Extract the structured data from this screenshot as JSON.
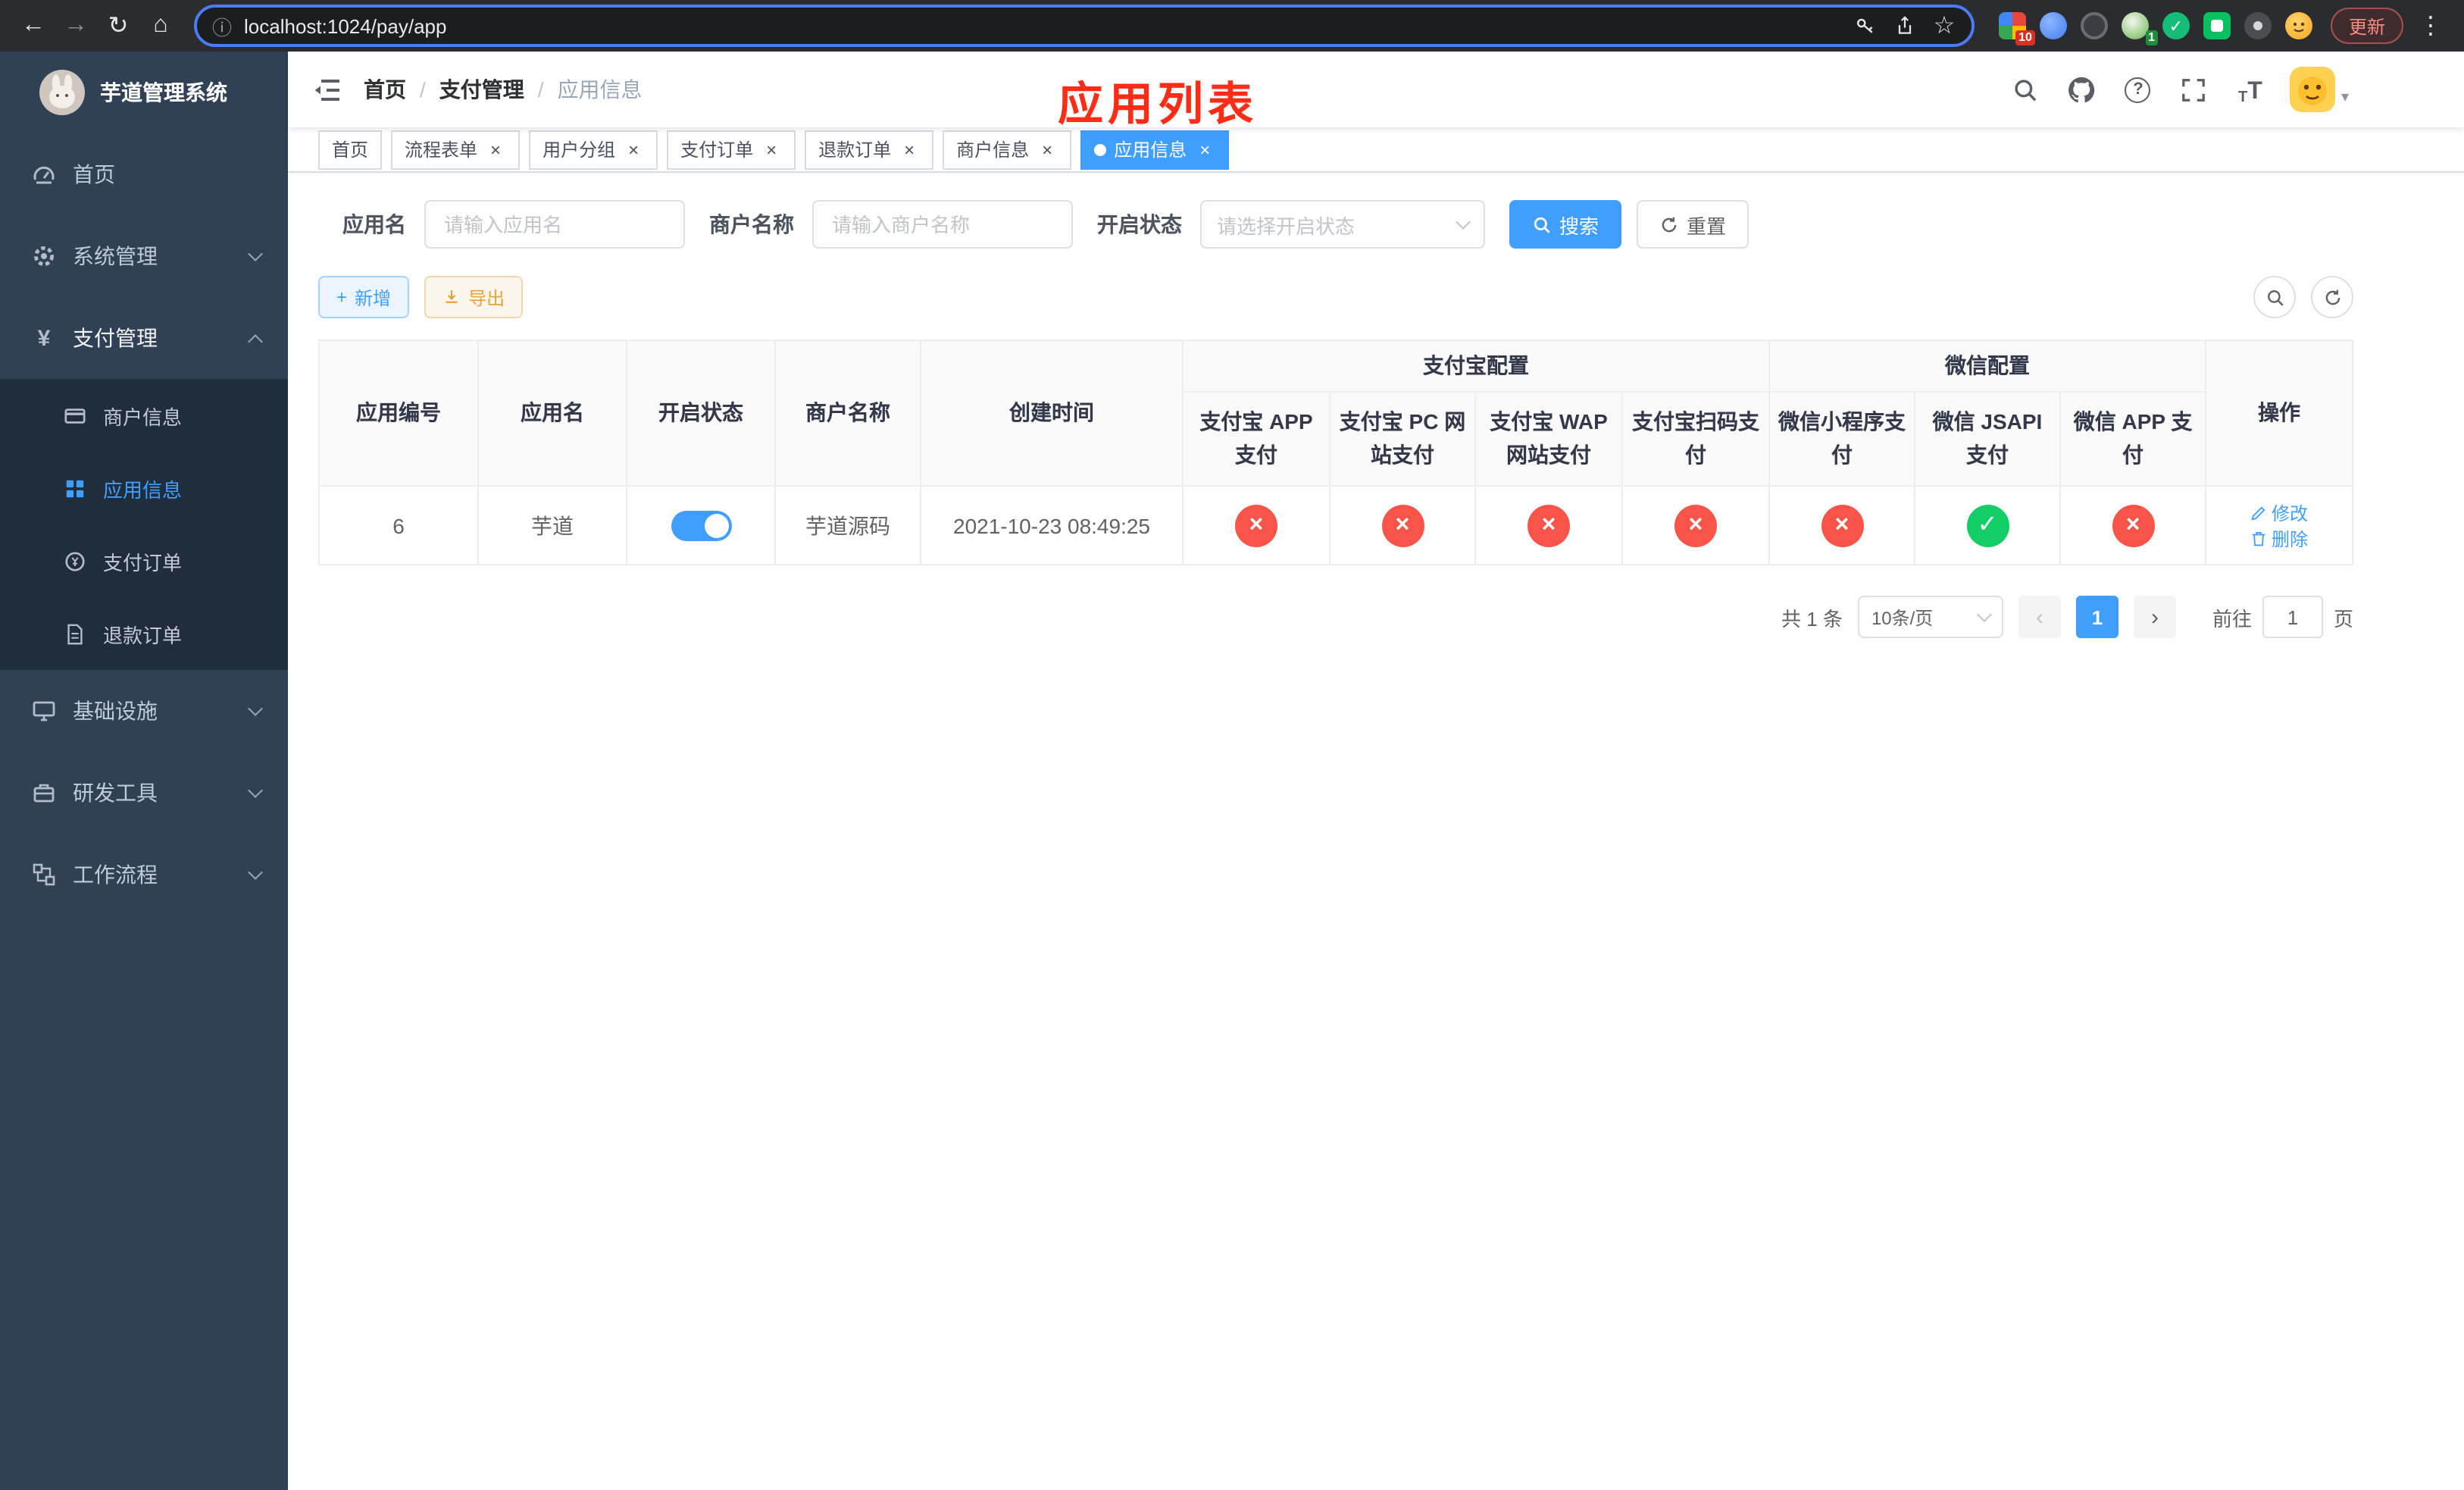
{
  "colors": {
    "accent": "#409eff",
    "success": "#13ce66",
    "danger": "#f9544a",
    "warning": "#e6a23c",
    "annotation_red": "#ff2d17",
    "sidebar_bg": "#304156",
    "submenu_bg": "#1f2d3d"
  },
  "icons": {
    "back": "←",
    "forward": "→",
    "reload": "↻",
    "home": "⌂",
    "info": "ⓘ",
    "star": "☆",
    "menu_dots": "⋮",
    "cross": "×",
    "check": "✓",
    "plus": "+",
    "prev": "‹",
    "next": "›",
    "question": "?",
    "yen": "¥",
    "caret_down": "▾"
  },
  "browser": {
    "url": "localhost:1024/pay/app",
    "update_label": "更新",
    "ext_badge_primary": "10",
    "ext_badge_secondary": "1"
  },
  "sidebar": {
    "title": "芋道管理系统",
    "items": [
      {
        "label": "首页"
      },
      {
        "label": "系统管理"
      },
      {
        "label": "支付管理"
      },
      {
        "label": "基础设施"
      },
      {
        "label": "研发工具"
      },
      {
        "label": "工作流程"
      }
    ],
    "payment_children": [
      {
        "label": "商户信息"
      },
      {
        "label": "应用信息"
      },
      {
        "label": "支付订单"
      },
      {
        "label": "退款订单"
      }
    ]
  },
  "header": {
    "breadcrumb": [
      "首页",
      "支付管理",
      "应用信息"
    ],
    "separator": "/",
    "annotation": "应用列表"
  },
  "tabs": [
    {
      "label": "首页",
      "closable": false,
      "active": false
    },
    {
      "label": "流程表单",
      "closable": true,
      "active": false
    },
    {
      "label": "用户分组",
      "closable": true,
      "active": false
    },
    {
      "label": "支付订单",
      "closable": true,
      "active": false
    },
    {
      "label": "退款订单",
      "closable": true,
      "active": false
    },
    {
      "label": "商户信息",
      "closable": true,
      "active": false
    },
    {
      "label": "应用信息",
      "closable": true,
      "active": true
    }
  ],
  "filters": {
    "app_name_label": "应用名",
    "app_name_placeholder": "请输入应用名",
    "merchant_label": "商户名称",
    "merchant_placeholder": "请输入商户名称",
    "status_label": "开启状态",
    "status_placeholder": "请选择开启状态",
    "search_label": "搜索",
    "reset_label": "重置"
  },
  "toolbar": {
    "add_label": "新增",
    "export_label": "导出"
  },
  "table": {
    "columns_simple": [
      "应用编号",
      "应用名",
      "开启状态",
      "商户名称",
      "创建时间"
    ],
    "groups": [
      {
        "label": "支付宝配置",
        "columns": [
          "支付宝 APP 支付",
          "支付宝 PC 网站支付",
          "支付宝 WAP 网站支付",
          "支付宝扫码支付"
        ]
      },
      {
        "label": "微信配置",
        "columns": [
          "微信小程序支付",
          "微信 JSAPI 支付",
          "微信 APP 支付"
        ]
      }
    ],
    "ops_label": "操作",
    "row": {
      "id": "6",
      "name": "芋道",
      "enabled": true,
      "merchant": "芋道源码",
      "created_at": "2021-10-23 08:49:25",
      "configs": [
        false,
        false,
        false,
        false,
        false,
        true,
        false
      ],
      "edit_label": "修改",
      "delete_label": "删除"
    }
  },
  "pagination": {
    "total": "共 1 条",
    "page_size": "10条/页",
    "current_page": "1",
    "goto_label": "前往",
    "goto_value": "1",
    "unit_label": "页"
  }
}
